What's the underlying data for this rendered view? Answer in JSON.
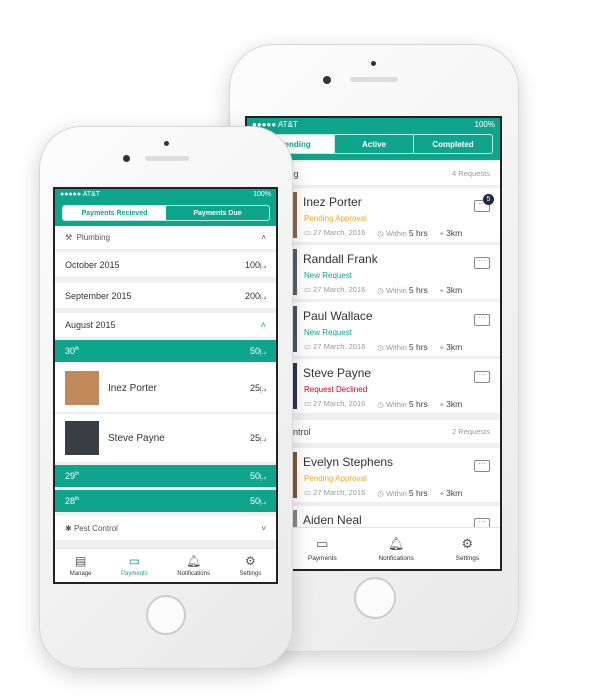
{
  "colors": {
    "accent": "#0ea58c",
    "pending": "#f5a623",
    "new": "#0ea58c",
    "declined": "#d0021b"
  },
  "status_bar": {
    "carrier": "●●●●● AT&T",
    "battery": "100%"
  },
  "back_phone": {
    "tabs": [
      "Pending",
      "Active",
      "Completed"
    ],
    "active_tab": "Pending",
    "sections": [
      {
        "name": "Plumbing",
        "count": "4 Requests"
      },
      {
        "name": "Pest Control",
        "count": "2 Requests"
      }
    ],
    "requests": [
      {
        "name": "Inez Porter",
        "status": "Pending Approval",
        "status_type": "pending",
        "date": "27 March, 2016",
        "within_label": "Within",
        "within": "5 hrs",
        "distance": "3km",
        "badge": "5"
      },
      {
        "name": "Randall Frank",
        "status": "New Request",
        "status_type": "new",
        "date": "27 March, 2016",
        "within_label": "Within",
        "within": "5 hrs",
        "distance": "3km"
      },
      {
        "name": "Paul Wallace",
        "status": "New Request",
        "status_type": "new",
        "date": "27 March, 2016",
        "within_label": "Within",
        "within": "5 hrs",
        "distance": "3km"
      },
      {
        "name": "Steve Payne",
        "status": "Request Declined",
        "status_type": "declined",
        "date": "27 March, 2016",
        "within_label": "Within",
        "within": "5 hrs",
        "distance": "3km"
      },
      {
        "name": "Evelyn Stephens",
        "status": "Pending Approval",
        "status_type": "pending",
        "date": "27 March, 2016",
        "within_label": "Within",
        "within": "5 hrs",
        "distance": "3km"
      },
      {
        "name": "Aiden Neal"
      }
    ],
    "tabbar": [
      {
        "label": "Payments",
        "icon": "card-icon"
      },
      {
        "label": "Notifications",
        "icon": "bell-icon"
      },
      {
        "label": "Settings",
        "icon": "gear-icon"
      }
    ]
  },
  "front_phone": {
    "tabs": [
      "Payments Recieved",
      "Payments Due"
    ],
    "active_tab": "Payments Recieved",
    "plumbing_label": "Plumbing",
    "months": [
      {
        "label": "October 2015",
        "amount": "100",
        "currency": "د.إ"
      },
      {
        "label": "September 2015",
        "amount": "200",
        "currency": "د.إ"
      }
    ],
    "august_label": "August 2015",
    "days": [
      {
        "day": "30",
        "suffix": "th",
        "amount": "50",
        "currency": "د.إ"
      },
      {
        "day": "29",
        "suffix": "th",
        "amount": "50",
        "currency": "د.إ"
      },
      {
        "day": "28",
        "suffix": "th",
        "amount": "50",
        "currency": "د.إ"
      }
    ],
    "payers": [
      {
        "name": "Inez Porter",
        "amount": "25",
        "currency": "د.إ"
      },
      {
        "name": "Steve Payne",
        "amount": "25",
        "currency": "د.إ"
      }
    ],
    "pest_label": "Pest Control",
    "tabbar": [
      {
        "label": "Manage",
        "icon": "clipboard-icon"
      },
      {
        "label": "Payments",
        "icon": "card-icon",
        "active": true
      },
      {
        "label": "Notifications",
        "icon": "bell-icon"
      },
      {
        "label": "Settings",
        "icon": "gear-icon"
      }
    ]
  }
}
